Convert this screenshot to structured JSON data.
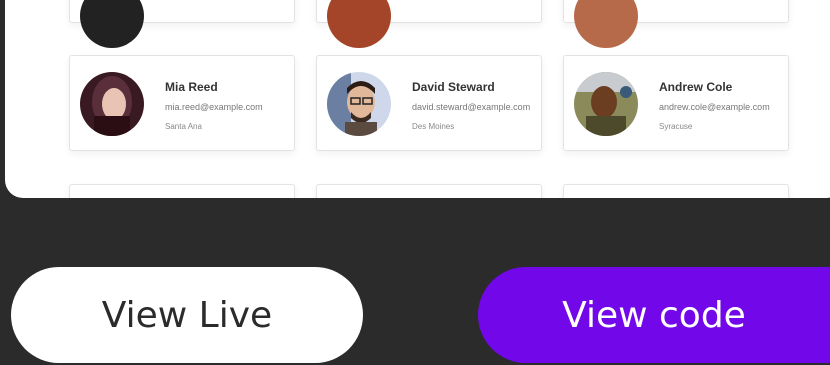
{
  "cards": [
    {
      "name": "Mia Reed",
      "email": "mia.reed@example.com",
      "city": "Santa Ana",
      "avatar_color": "#5a2e3a"
    },
    {
      "name": "David Steward",
      "email": "david.steward@example.com",
      "city": "Des Moines",
      "avatar_color": "#6b7fa3"
    },
    {
      "name": "Andrew Cole",
      "email": "andrew.cole@example.com",
      "city": "Syracuse",
      "avatar_color": "#4c4a2a"
    }
  ],
  "buttons": {
    "view_live": "View Live",
    "view_code": "View code"
  },
  "colors": {
    "background": "#2b2b2b",
    "accent": "#7208ea"
  }
}
